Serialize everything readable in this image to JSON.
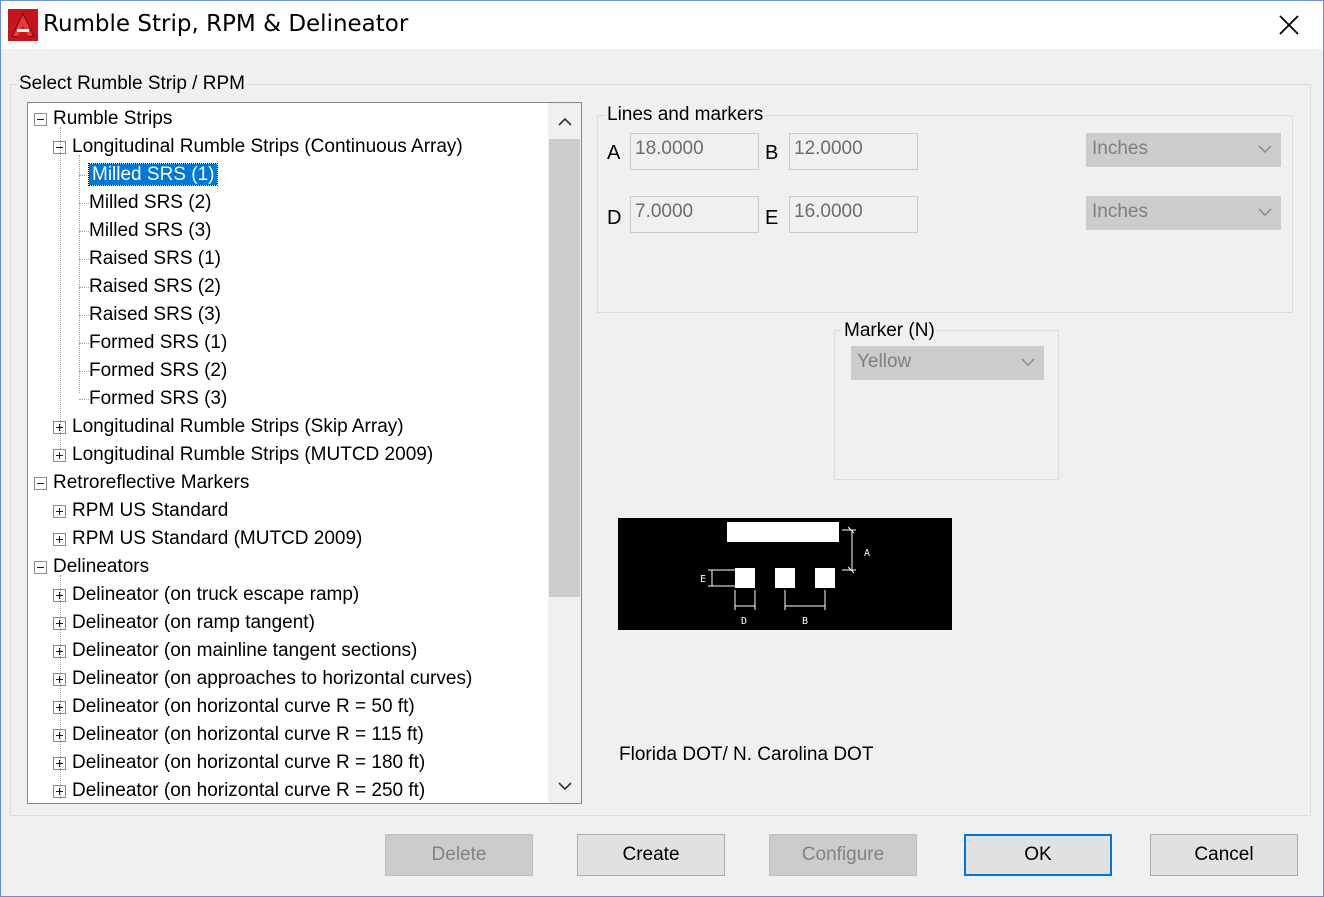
{
  "window": {
    "title": "Rumble Strip, RPM & Delineator"
  },
  "select_group": {
    "label": "Select Rumble Strip / RPM"
  },
  "tree": {
    "rows": [
      {
        "label": "Rumble Strips",
        "level": 0,
        "expander": "minus"
      },
      {
        "label": "Longitudinal Rumble Strips (Continuous Array)",
        "level": 1,
        "expander": "minus"
      },
      {
        "label": "Milled SRS (1)",
        "level": 2,
        "expander": "none",
        "selected": true
      },
      {
        "label": "Milled SRS (2)",
        "level": 2,
        "expander": "none"
      },
      {
        "label": "Milled SRS (3)",
        "level": 2,
        "expander": "none"
      },
      {
        "label": "Raised SRS (1)",
        "level": 2,
        "expander": "none"
      },
      {
        "label": "Raised SRS (2)",
        "level": 2,
        "expander": "none"
      },
      {
        "label": "Raised SRS (3)",
        "level": 2,
        "expander": "none"
      },
      {
        "label": "Formed SRS (1)",
        "level": 2,
        "expander": "none"
      },
      {
        "label": "Formed SRS (2)",
        "level": 2,
        "expander": "none"
      },
      {
        "label": "Formed SRS (3)",
        "level": 2,
        "expander": "none"
      },
      {
        "label": "Longitudinal Rumble Strips (Skip Array)",
        "level": 1,
        "expander": "plus"
      },
      {
        "label": "Longitudinal Rumble Strips (MUTCD 2009)",
        "level": 1,
        "expander": "plus"
      },
      {
        "label": "Retroreflective Markers",
        "level": 0,
        "expander": "minus"
      },
      {
        "label": "RPM US Standard",
        "level": 1,
        "expander": "plus"
      },
      {
        "label": "RPM US Standard (MUTCD 2009)",
        "level": 1,
        "expander": "plus"
      },
      {
        "label": "Delineators",
        "level": 0,
        "expander": "minus"
      },
      {
        "label": "Delineator (on truck escape ramp)",
        "level": 1,
        "expander": "plus"
      },
      {
        "label": "Delineator (on ramp tangent)",
        "level": 1,
        "expander": "plus"
      },
      {
        "label": "Delineator (on mainline tangent sections)",
        "level": 1,
        "expander": "plus"
      },
      {
        "label": "Delineator (on approaches to horizontal curves)",
        "level": 1,
        "expander": "plus"
      },
      {
        "label": "Delineator (on horizontal curve R = 50 ft)",
        "level": 1,
        "expander": "plus"
      },
      {
        "label": "Delineator (on horizontal curve R = 115 ft)",
        "level": 1,
        "expander": "plus"
      },
      {
        "label": "Delineator (on horizontal curve R = 180 ft)",
        "level": 1,
        "expander": "plus"
      },
      {
        "label": "Delineator (on horizontal curve R = 250 ft)",
        "level": 1,
        "expander": "plus"
      }
    ]
  },
  "lines_markers": {
    "label": "Lines and markers",
    "a_label": "A",
    "a_value": "18.0000",
    "b_label": "B",
    "b_value": "12.0000",
    "d_label": "D",
    "d_value": "7.0000",
    "e_label": "E",
    "e_value": "16.0000",
    "unit1": "Inches",
    "unit2": "Inches"
  },
  "marker": {
    "label": "Marker (N)",
    "value": "Yellow"
  },
  "diagram": {
    "label_a": "A",
    "label_b": "B",
    "label_d": "D",
    "label_e": "E"
  },
  "source_note": "Florida DOT/ N. Carolina DOT",
  "buttons": {
    "delete": "Delete",
    "create": "Create",
    "configure": "Configure",
    "ok": "OK",
    "cancel": "Cancel"
  },
  "icons": {
    "app": "autocad-icon",
    "close": "close-icon"
  }
}
